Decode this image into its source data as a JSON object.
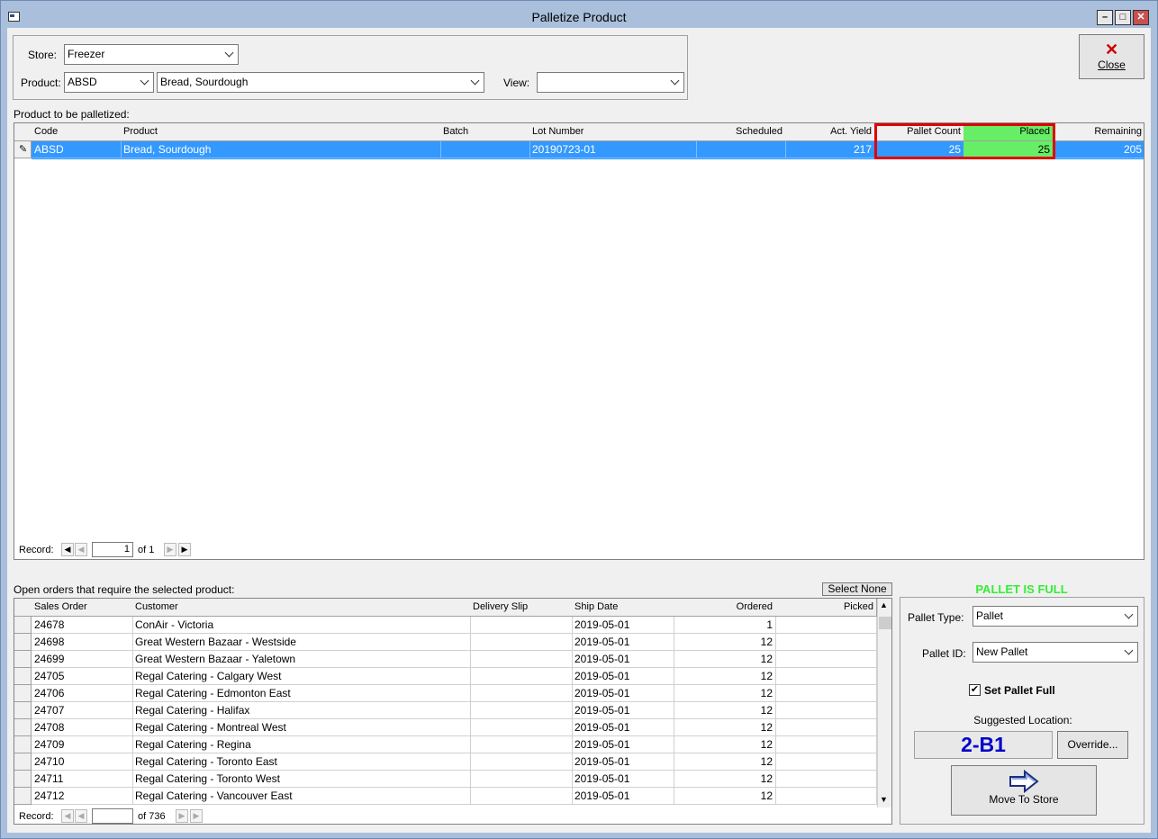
{
  "window": {
    "title": "Palletize Product"
  },
  "filters": {
    "store_label": "Store:",
    "store_value": "Freezer",
    "product_label": "Product:",
    "product_code": "ABSD",
    "product_name": "Bread, Sourdough",
    "view_label": "View:",
    "view_value": ""
  },
  "close_button": {
    "label": "Close"
  },
  "product_grid": {
    "caption": "Product to be palletized:",
    "columns": [
      "Code",
      "Product",
      "Batch",
      "Lot Number",
      "Scheduled",
      "Act. Yield",
      "Pallet Count",
      "Placed",
      "Remaining"
    ],
    "rows": [
      {
        "code": "ABSD",
        "product": "Bread, Sourdough",
        "batch": "",
        "lot": "20190723-01",
        "scheduled": "",
        "yield": "217",
        "pallet_count": "25",
        "placed": "25",
        "remaining": "205"
      }
    ],
    "nav": {
      "record_label": "Record:",
      "current": "1",
      "of_total": "of 1"
    }
  },
  "orders_grid": {
    "caption": "Open orders that require the selected product:",
    "select_none_label": "Select None",
    "columns": [
      "Sales Order",
      "Customer",
      "Delivery Slip",
      "Ship Date",
      "Ordered",
      "Picked"
    ],
    "rows": [
      {
        "so": "24678",
        "customer": "ConAir - Victoria",
        "slip": "",
        "date": "2019-05-01",
        "ordered": "1",
        "picked": ""
      },
      {
        "so": "24698",
        "customer": "Great Western Bazaar - Westside",
        "slip": "",
        "date": "2019-05-01",
        "ordered": "12",
        "picked": ""
      },
      {
        "so": "24699",
        "customer": "Great Western Bazaar - Yaletown",
        "slip": "",
        "date": "2019-05-01",
        "ordered": "12",
        "picked": ""
      },
      {
        "so": "24705",
        "customer": "Regal Catering - Calgary West",
        "slip": "",
        "date": "2019-05-01",
        "ordered": "12",
        "picked": ""
      },
      {
        "so": "24706",
        "customer": "Regal Catering - Edmonton East",
        "slip": "",
        "date": "2019-05-01",
        "ordered": "12",
        "picked": ""
      },
      {
        "so": "24707",
        "customer": "Regal Catering - Halifax",
        "slip": "",
        "date": "2019-05-01",
        "ordered": "12",
        "picked": ""
      },
      {
        "so": "24708",
        "customer": "Regal Catering - Montreal West",
        "slip": "",
        "date": "2019-05-01",
        "ordered": "12",
        "picked": ""
      },
      {
        "so": "24709",
        "customer": "Regal Catering - Regina",
        "slip": "",
        "date": "2019-05-01",
        "ordered": "12",
        "picked": ""
      },
      {
        "so": "24710",
        "customer": "Regal Catering - Toronto East",
        "slip": "",
        "date": "2019-05-01",
        "ordered": "12",
        "picked": ""
      },
      {
        "so": "24711",
        "customer": "Regal Catering - Toronto West",
        "slip": "",
        "date": "2019-05-01",
        "ordered": "12",
        "picked": ""
      },
      {
        "so": "24712",
        "customer": "Regal Catering - Vancouver East",
        "slip": "",
        "date": "2019-05-01",
        "ordered": "12",
        "picked": ""
      }
    ],
    "nav": {
      "record_label": "Record:",
      "current": "",
      "of_total": "of 736"
    }
  },
  "pallet_panel": {
    "status": "PALLET IS FULL",
    "status_color": "#33ee33",
    "pallet_type_label": "Pallet Type:",
    "pallet_type_value": "Pallet",
    "pallet_id_label": "Pallet ID:",
    "pallet_id_value": "New Pallet",
    "set_full_label": "Set Pallet Full",
    "set_full_checked": true,
    "suggested_label": "Suggested Location:",
    "suggested_value": "2-B1",
    "override_label": "Override...",
    "move_label": "Move To Store"
  },
  "colors": {
    "selection": "#3399ff",
    "placed_highlight": "#66ee66",
    "highlight_border": "#e00000",
    "location_text": "#0000cc"
  }
}
